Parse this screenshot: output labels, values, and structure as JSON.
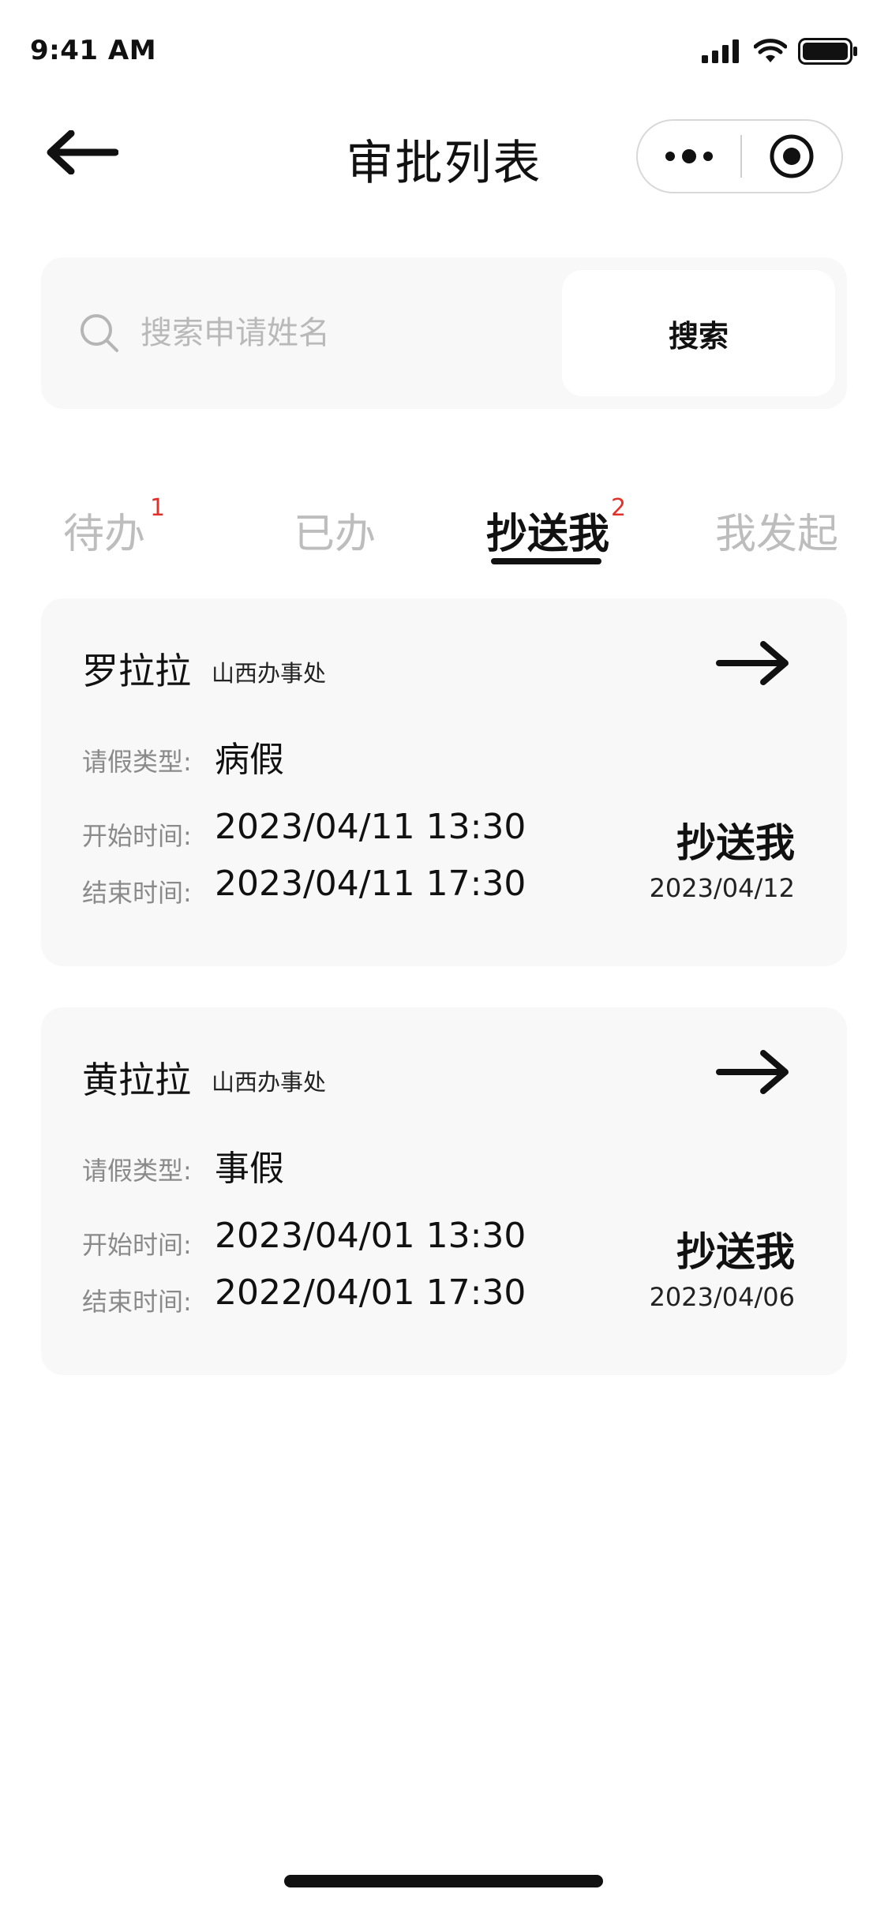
{
  "status_bar": {
    "time": "9:41 AM"
  },
  "nav": {
    "title": "审批列表"
  },
  "search": {
    "placeholder": "搜索申请姓名",
    "button_label": "搜索"
  },
  "tabs": [
    {
      "label": "待办",
      "badge": "1"
    },
    {
      "label": "已办",
      "badge": ""
    },
    {
      "label": "抄送我",
      "badge": "2"
    },
    {
      "label": "我发起",
      "badge": ""
    }
  ],
  "records": [
    {
      "name": "罗拉拉",
      "department": "山西办事处",
      "leave_type_label": "请假类型:",
      "leave_type": "病假",
      "start_label": "开始时间:",
      "start_time": "2023/04/11 13:30",
      "end_label": "结束时间:",
      "end_time": "2023/04/11 17:30",
      "status": "抄送我",
      "date": "2023/04/12"
    },
    {
      "name": "黄拉拉",
      "department": "山西办事处",
      "leave_type_label": "请假类型:",
      "leave_type": "事假",
      "start_label": "开始时间:",
      "start_time": "2023/04/01 13:30",
      "end_label": "结束时间:",
      "end_time": "2022/04/01 17:30",
      "status": "抄送我",
      "date": "2023/04/06"
    }
  ],
  "colors": {
    "badge": "#e0312b",
    "card_bg": "#f8f8f8",
    "inactive_tab": "#bdbdbd"
  }
}
